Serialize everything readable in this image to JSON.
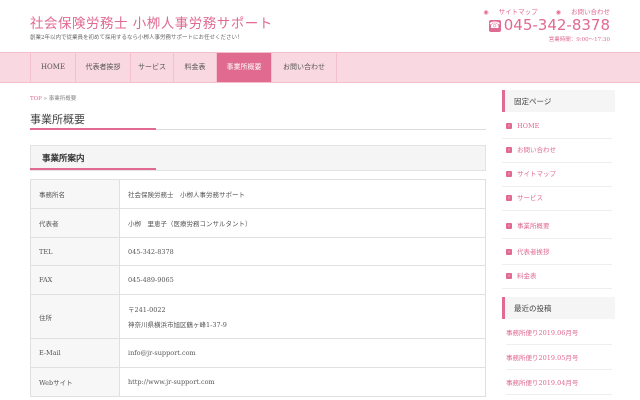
{
  "header": {
    "site_title": "社会保険労務士 小栁人事労務サポート",
    "tagline": "創業2年以内で従業員を初めて採用するなら小栁人事労務サポートにお任せください！",
    "top_links": [
      {
        "icon": "circle-chevron-icon",
        "label": "サイトマップ"
      },
      {
        "icon": "circle-chevron-icon",
        "label": "お問い合わせ"
      }
    ],
    "phone_icon": "phone-icon",
    "phone": "045-342-8378",
    "hours": "営業時間：9:00～17:30"
  },
  "nav": {
    "items": [
      {
        "label": "HOME"
      },
      {
        "label": "代表者挨拶"
      },
      {
        "label": "サービス"
      },
      {
        "label": "料金表"
      },
      {
        "label": "事業所概要"
      },
      {
        "label": "お問い合わせ"
      }
    ],
    "active_index": 4
  },
  "breadcrumb": {
    "home": "TOP",
    "separator": "»",
    "current": "事業所概要"
  },
  "main": {
    "page_title": "事業所概要",
    "section_title": "事業所案内",
    "rows": [
      {
        "key": "事務所名",
        "value": "社会保険労務士　小栁人事労務サポート"
      },
      {
        "key": "代表者",
        "value": "小栁　里恵子（医療労務コンサルタント）"
      },
      {
        "key": "TEL",
        "value": "045-342-8378"
      },
      {
        "key": "FAX",
        "value": "045-489-9065"
      },
      {
        "key": "住所",
        "value": "〒241-0022",
        "value2": "神奈川県横浜市旭区鶴ヶ峰1-37-9"
      },
      {
        "key": "E-Mail",
        "value": "info@jr-support.com"
      },
      {
        "key": "Webサイト",
        "value": "http://www.jr-support.com"
      }
    ]
  },
  "sidebar": {
    "fixed_heading": "固定ページ",
    "fixed_items": [
      {
        "label": "HOME"
      },
      {
        "label": "お問い合わせ"
      },
      {
        "label": "サイトマップ"
      },
      {
        "label": "サービス"
      },
      {
        "label": "事業所概要"
      },
      {
        "label": "代表者挨拶"
      },
      {
        "label": "料金表"
      }
    ],
    "recent_heading": "最近の投稿",
    "recent_items": [
      {
        "label": "事務所便り2019.06月号"
      },
      {
        "label": "事務所便り2019.05月号"
      },
      {
        "label": "事務所便り2019.04月号"
      }
    ]
  },
  "colors": {
    "accent": "#e06a90",
    "nav_bg": "#f9d8e1"
  }
}
